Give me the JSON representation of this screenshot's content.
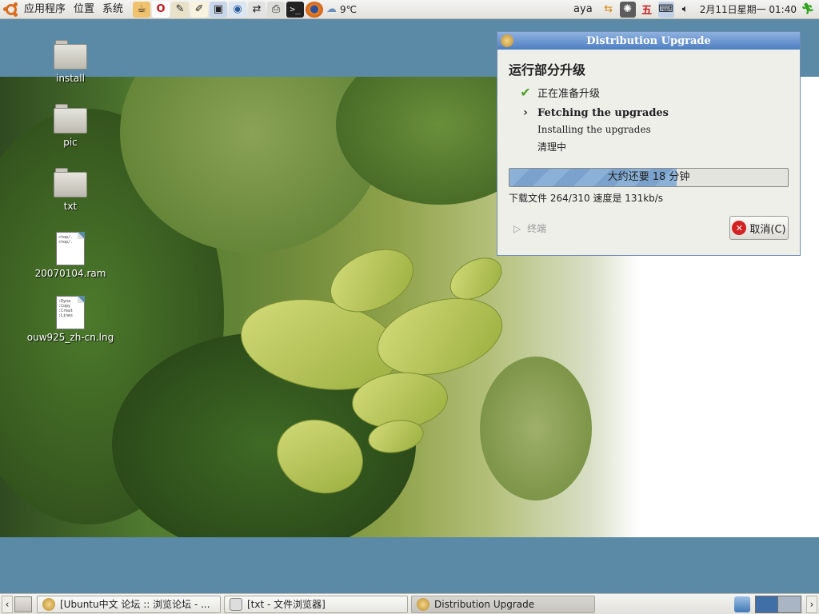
{
  "top_panel": {
    "menus": [
      "应用程序",
      "位置",
      "系统"
    ],
    "launchers": [
      "lotus-icon",
      "opera-icon",
      "tools-icon",
      "editor-icon",
      "monitor-icon",
      "eye-icon",
      "network-icon",
      "printer-icon",
      "terminal-icon",
      "firefox-icon"
    ],
    "weather": "9℃",
    "user": "aya",
    "tray_icons": [
      "network-arrows-icon",
      "sparkle-icon",
      "input-method-icon",
      "computer-icon",
      "volume-icon"
    ],
    "input_method_label": "五",
    "clock": "2月11日星期一 01:40"
  },
  "desktop_icons": [
    {
      "label": "install",
      "kind": "folder"
    },
    {
      "label": "pic",
      "kind": "folder"
    },
    {
      "label": "txt",
      "kind": "folder"
    },
    {
      "label": "20070104.ram",
      "kind": "document",
      "preview": "<top/.\n<top/.\n"
    },
    {
      "label": "ouw925_zh-cn.lng",
      "kind": "document",
      "preview": ":Dyna\n:Copy\n:Creat\n:Lines"
    }
  ],
  "dialog": {
    "title": "Distribution Upgrade",
    "heading": "运行部分升级",
    "steps": [
      {
        "label": "正在准备升级",
        "state": "done"
      },
      {
        "label": "Fetching the upgrades",
        "state": "current"
      },
      {
        "label": "Installing the upgrades",
        "state": "pending"
      },
      {
        "label": "清理中",
        "state": "pending"
      }
    ],
    "progress": {
      "text": "大约还要 18 分钟",
      "fraction": 0.6
    },
    "download_status": "下载文件 264/310 速度是 131kb/s",
    "terminal_label": "终端",
    "cancel_label": "取消(C)",
    "colors": {
      "title_bar": "#4d7ec2",
      "progress_fill": "#8cb1d9",
      "check": "#4ba12a",
      "cancel_icon": "#d22222"
    }
  },
  "bottom_panel": {
    "tasks": [
      {
        "label": "[Ubuntu中文 论坛 :: 浏览论坛 - ...",
        "active": false
      },
      {
        "label": "[txt - 文件浏览器]",
        "active": false
      },
      {
        "label": "Distribution Upgrade",
        "active": true
      }
    ],
    "workspaces": 2,
    "current_workspace": 1
  }
}
